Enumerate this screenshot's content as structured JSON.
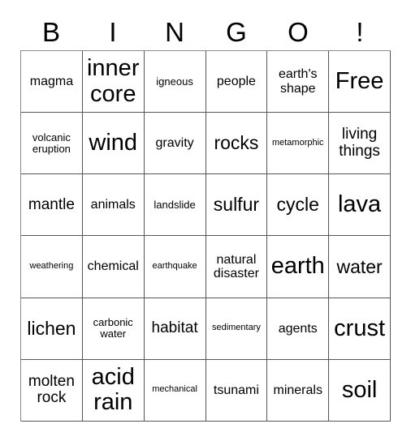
{
  "header": {
    "letters": [
      "B",
      "I",
      "N",
      "G",
      "O",
      "!"
    ]
  },
  "grid": {
    "columns": 6,
    "rows": 6,
    "cells": [
      {
        "text": "magma",
        "size": "fs-m"
      },
      {
        "text": "inner core",
        "size": "fs-xxl"
      },
      {
        "text": "igneous",
        "size": "fs-s"
      },
      {
        "text": "people",
        "size": "fs-m"
      },
      {
        "text": "earth's shape",
        "size": "fs-m"
      },
      {
        "text": "Free",
        "size": "fs-xxl"
      },
      {
        "text": "volcanic eruption",
        "size": "fs-s"
      },
      {
        "text": "wind",
        "size": "fs-xxl"
      },
      {
        "text": "gravity",
        "size": "fs-m"
      },
      {
        "text": "rocks",
        "size": "fs-xl"
      },
      {
        "text": "metamorphic",
        "size": "fs-xs"
      },
      {
        "text": "living things",
        "size": "fs-l"
      },
      {
        "text": "mantle",
        "size": "fs-l"
      },
      {
        "text": "animals",
        "size": "fs-m"
      },
      {
        "text": "landslide",
        "size": "fs-s"
      },
      {
        "text": "sulfur",
        "size": "fs-xl"
      },
      {
        "text": "cycle",
        "size": "fs-xl"
      },
      {
        "text": "lava",
        "size": "fs-xxl"
      },
      {
        "text": "weathering",
        "size": "fs-xs"
      },
      {
        "text": "chemical",
        "size": "fs-m"
      },
      {
        "text": "earthquake",
        "size": "fs-xs"
      },
      {
        "text": "natural disaster",
        "size": "fs-m"
      },
      {
        "text": "earth",
        "size": "fs-xxl"
      },
      {
        "text": "water",
        "size": "fs-xl"
      },
      {
        "text": "lichen",
        "size": "fs-xl"
      },
      {
        "text": "carbonic water",
        "size": "fs-s"
      },
      {
        "text": "habitat",
        "size": "fs-l"
      },
      {
        "text": "sedimentary",
        "size": "fs-xs"
      },
      {
        "text": "agents",
        "size": "fs-m"
      },
      {
        "text": "crust",
        "size": "fs-xxl"
      },
      {
        "text": "molten rock",
        "size": "fs-l"
      },
      {
        "text": "acid rain",
        "size": "fs-xxl"
      },
      {
        "text": "mechanical",
        "size": "fs-xs"
      },
      {
        "text": "tsunami",
        "size": "fs-m"
      },
      {
        "text": "minerals",
        "size": "fs-m"
      },
      {
        "text": "soil",
        "size": "fs-xxl"
      }
    ]
  }
}
